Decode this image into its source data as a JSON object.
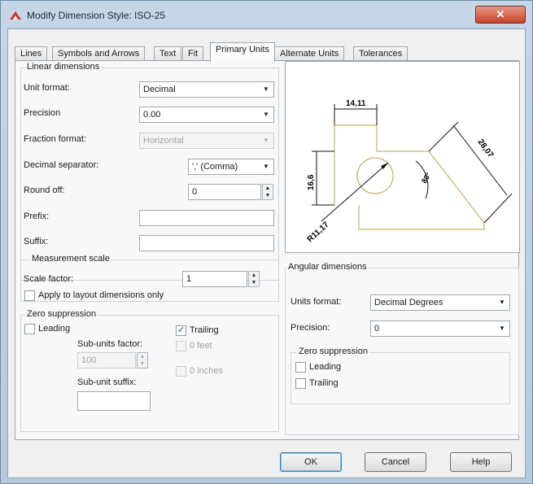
{
  "window": {
    "title": "Modify Dimension Style: ISO-25",
    "close_glyph": "✕"
  },
  "tabs": [
    {
      "label": "Lines"
    },
    {
      "label": "Symbols and Arrows"
    },
    {
      "label": "Text"
    },
    {
      "label": "Fit"
    },
    {
      "label": "Primary Units",
      "active": true
    },
    {
      "label": "Alternate Units"
    },
    {
      "label": "Tolerances"
    }
  ],
  "linear": {
    "title": "Linear dimensions",
    "unit_format_label": "Unit format:",
    "unit_format_value": "Decimal",
    "precision_label": "Precision",
    "precision_value": "0.00",
    "fraction_format_label": "Fraction format:",
    "fraction_format_value": "Horizontal",
    "decimal_separator_label": "Decimal separator:",
    "decimal_separator_value": "',' (Comma)",
    "round_off_label": "Round off:",
    "round_off_value": "0",
    "prefix_label": "Prefix:",
    "prefix_value": "",
    "suffix_label": "Suffix:",
    "suffix_value": ""
  },
  "measurement_scale": {
    "title": "Measurement scale",
    "scale_factor_label": "Scale factor:",
    "scale_factor_value": "1",
    "apply_layout_label": "Apply to layout dimensions only",
    "apply_layout_checked": false
  },
  "zero_suppression": {
    "title": "Zero suppression",
    "leading_label": "Leading",
    "leading_checked": false,
    "trailing_label": "Trailing",
    "trailing_checked": true,
    "sub_units_factor_label": "Sub-units factor:",
    "sub_units_factor_value": "100",
    "feet_label": "0 feet",
    "inches_label": "0 inches",
    "sub_unit_suffix_label": "Sub-unit suffix:",
    "sub_unit_suffix_value": ""
  },
  "preview": {
    "dim_top": "14,11",
    "dim_left": "16,6",
    "dim_right": "28,07",
    "dim_angle": "80°",
    "dim_radius": "R11,17"
  },
  "angular": {
    "title": "Angular dimensions",
    "units_format_label": "Units format:",
    "units_format_value": "Decimal Degrees",
    "precision_label": "Precision:",
    "precision_value": "0",
    "zero_title": "Zero suppression",
    "leading_label": "Leading",
    "leading_checked": false,
    "trailing_label": "Trailing",
    "trailing_checked": false
  },
  "buttons": {
    "ok": "OK",
    "cancel": "Cancel",
    "help": "Help"
  },
  "glyphs": {
    "dropdown": "▼",
    "spin_up": "▲",
    "spin_down": "▼",
    "check": "✓"
  },
  "colors": {
    "title_bar": "#c6d6e6",
    "close_button": "#c7422a",
    "preview_part": "#c8b26a"
  }
}
